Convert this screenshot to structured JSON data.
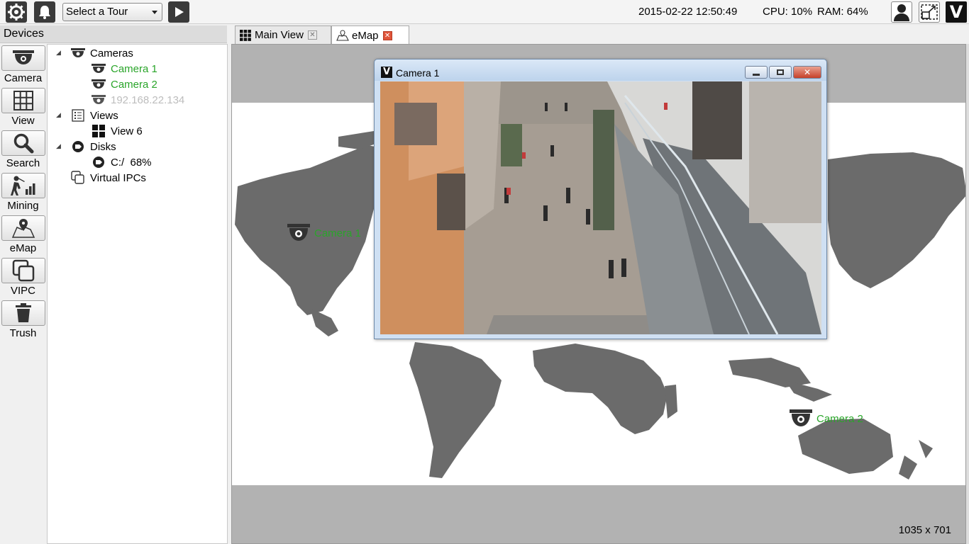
{
  "toolbar": {
    "tour_select": "Select a Tour",
    "datetime": "2015-02-22 12:50:49",
    "cpu": "CPU: 10%",
    "ram": "RAM: 64%",
    "logo": "V"
  },
  "left_panel": {
    "title": "Devices"
  },
  "side_nav": [
    {
      "label": "Camera",
      "icon": "dome-camera-icon"
    },
    {
      "label": "View",
      "icon": "grid-icon"
    },
    {
      "label": "Search",
      "icon": "magnifier-icon"
    },
    {
      "label": "Mining",
      "icon": "mining-icon"
    },
    {
      "label": "eMap",
      "icon": "map-pin-icon"
    },
    {
      "label": "VIPC",
      "icon": "stacked-windows-icon"
    },
    {
      "label": "Trush",
      "icon": "trash-icon"
    }
  ],
  "tree": {
    "cameras": "Cameras",
    "camera1": "Camera 1",
    "camera2": "Camera 2",
    "ip_camera": "192.168.22.134",
    "views": "Views",
    "view6": "View 6",
    "disks": "Disks",
    "disk_c": "C:/  68%",
    "virtual_ipcs": "Virtual IPCs"
  },
  "tabs": [
    {
      "label": "Main View",
      "icon": "grid-icon"
    },
    {
      "label": "eMap",
      "icon": "map-icon",
      "active": true
    }
  ],
  "emap": {
    "markers": [
      {
        "label": "Camera 1",
        "icon": "dome-camera-icon"
      },
      {
        "label": "Camera 2",
        "icon": "dome-camera-icon"
      }
    ],
    "map_size": "1035 x 701"
  },
  "camera_window": {
    "title": "Camera 1",
    "logo": "V"
  },
  "colors": {
    "online_green": "#2aa52a",
    "offline_grey": "#bdbdbd",
    "map_land": "#6b6b6b",
    "map_bg": "#b2b2b2"
  }
}
